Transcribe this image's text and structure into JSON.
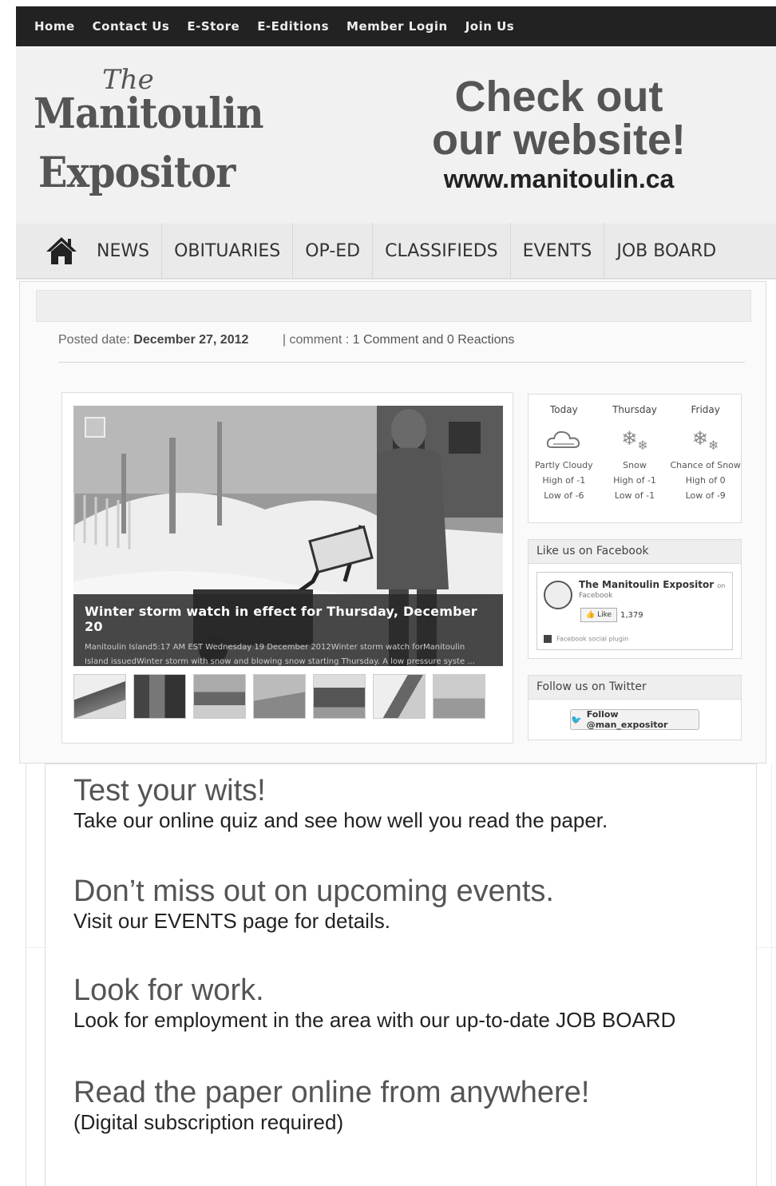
{
  "top_nav": [
    "Home",
    "Contact Us",
    "E-Store",
    "E-Editions",
    "Member Login",
    "Join Us"
  ],
  "logo": {
    "the": "The",
    "line1": "Manitoulin",
    "line2": "Expositor"
  },
  "promo": {
    "line1": "Check out",
    "line2": "our website!",
    "url": "www.manitoulin.ca"
  },
  "main_nav": [
    "NEWS",
    "OBITUARIES",
    "OP-ED",
    "CLASSIFIEDS",
    "EVENTS",
    "JOB BOARD"
  ],
  "post": {
    "posted_label": "Posted date:",
    "posted_date": "December 27, 2012",
    "comment_label": "| comment :",
    "comment_value": "1 Comment and 0 Reactions"
  },
  "slide": {
    "title": "Winter storm watch in effect for Thursday, December 20",
    "summary_1": "Manitoulin Island5:17 AM EST Wednesday 19 December 2012Winter storm watch forManitoulin",
    "summary_2": "Island issuedWinter storm with snow and blowing snow starting Thursday. A low pressure syste ..."
  },
  "weather": [
    {
      "day": "Today",
      "condition": "Partly Cloudy",
      "high": "High of -1",
      "low": "Low of -6",
      "icon": "cloud-icon"
    },
    {
      "day": "Thursday",
      "condition": "Snow",
      "high": "High of -1",
      "low": "Low of -1",
      "icon": "snowflake-icon"
    },
    {
      "day": "Friday",
      "condition": "Chance of Snow",
      "high": "High of 0",
      "low": "Low of -9",
      "icon": "snowflake-icon"
    }
  ],
  "facebook": {
    "heading": "Like us on Facebook",
    "page_name": "The Manitoulin Expositor",
    "on": "on",
    "network": "Facebook",
    "like": "Like",
    "count": "1,379",
    "plugin": "Facebook social plugin"
  },
  "twitter": {
    "heading": "Follow us on Twitter",
    "button": "Follow @man_expositor"
  },
  "promos": [
    {
      "heading": "Test your wits!",
      "text": "Take our online quiz and see how well you read the paper."
    },
    {
      "heading": "Don’t miss out on upcoming events.",
      "text": "Visit our EVENTS page for details."
    },
    {
      "heading": "Look for work.",
      "text": "Look for employment in the area with our up-to-date JOB BOARD"
    },
    {
      "heading": "Read the paper online from anywhere!",
      "text": "(Digital subscription required)"
    }
  ]
}
